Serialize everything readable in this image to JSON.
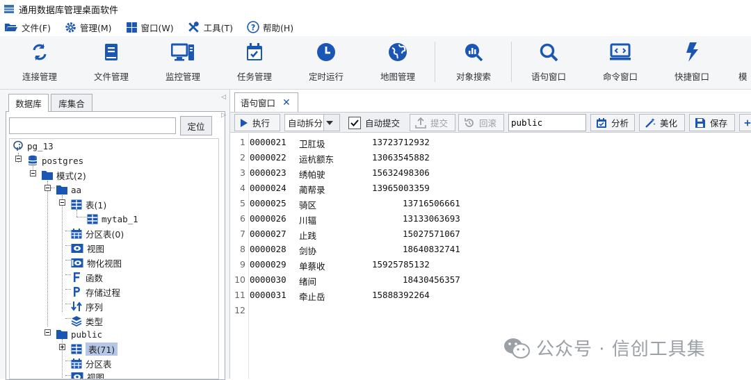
{
  "app": {
    "title": "通用数据库管理桌面软件"
  },
  "menu": [
    {
      "label": "文件(F)",
      "icon": "folder-open-icon"
    },
    {
      "label": "管理(M)",
      "icon": "gear-icon"
    },
    {
      "label": "窗口(W)",
      "icon": "windows-icon"
    },
    {
      "label": "工具(T)",
      "icon": "tools-icon"
    },
    {
      "label": "帮助(H)",
      "icon": "help-icon"
    }
  ],
  "toolbar": [
    {
      "label": "连接管理",
      "icon": "sync-icon"
    },
    {
      "label": "文件管理",
      "icon": "book-icon"
    },
    {
      "label": "监控管理",
      "icon": "monitor-icon"
    },
    {
      "label": "任务管理",
      "icon": "calendar-check-icon"
    },
    {
      "label": "定时运行",
      "icon": "clock-icon"
    },
    {
      "label": "地图管理",
      "icon": "globe-icon"
    },
    {
      "label": "对象搜索",
      "icon": "search-chart-icon"
    },
    {
      "label": "语句窗口",
      "icon": "search-icon"
    },
    {
      "label": "命令窗口",
      "icon": "terminal-icon"
    },
    {
      "label": "快捷窗口",
      "icon": "bolt-icon"
    },
    {
      "label": "模",
      "icon": ""
    }
  ],
  "left_panel": {
    "tabs": [
      "数据库",
      "库集合"
    ],
    "locate_button": "定位",
    "locate_input_value": "",
    "tree": [
      {
        "label": "pg_13",
        "icon": "elephant-icon",
        "mono": true
      },
      {
        "label": "postgres",
        "icon": "database-icon",
        "mono": true
      },
      {
        "label": "模式(2)",
        "icon": "folder-icon"
      },
      {
        "label": "aa",
        "icon": "folder-icon",
        "mono": true
      },
      {
        "label": "表(1)",
        "icon": "table-icon"
      },
      {
        "label": "mytab_1",
        "icon": "table-icon",
        "mono": true
      },
      {
        "label": "分区表(0)",
        "icon": "partition-table-icon"
      },
      {
        "label": "视图",
        "icon": "view-icon"
      },
      {
        "label": "物化视图",
        "icon": "materialized-view-icon"
      },
      {
        "label": "函数",
        "icon": "function-icon"
      },
      {
        "label": "存储过程",
        "icon": "procedure-icon"
      },
      {
        "label": "序列",
        "icon": "sequence-icon"
      },
      {
        "label": "类型",
        "icon": "type-icon"
      },
      {
        "label": "public",
        "icon": "folder-icon",
        "mono": true
      },
      {
        "label": "表(71)",
        "icon": "table-icon",
        "selected": true
      },
      {
        "label": "分区表",
        "icon": "partition-table-icon"
      },
      {
        "label": "视图",
        "icon": "view-icon"
      }
    ]
  },
  "sql_window": {
    "tab_label": "语句窗口",
    "toolbar": {
      "execute": "执行",
      "split_mode": "自动拆分",
      "auto_commit_label": "自动提交",
      "auto_commit_checked": true,
      "commit": "提交",
      "rollback": "回滚",
      "schema": "public",
      "analyze": "分析",
      "beautify": "美化",
      "save": "保存"
    },
    "lines": [
      {
        "n": "1",
        "id": "0000021",
        "name": "卫肛圾",
        "phone": "13723712932"
      },
      {
        "n": "2",
        "id": "0000022",
        "name": "运杭额东",
        "phone": "13063545882"
      },
      {
        "n": "3",
        "id": "0000023",
        "name": "绣帕驶",
        "phone": "15632498306"
      },
      {
        "n": "4",
        "id": "0000024",
        "name": "蔺帮录",
        "phone": "13965003359"
      },
      {
        "n": "5",
        "id": "0000025",
        "name": "骑区",
        "phone": "13716506661"
      },
      {
        "n": "6",
        "id": "0000026",
        "name": "川辐",
        "phone": "13133063693"
      },
      {
        "n": "7",
        "id": "0000027",
        "name": "止践",
        "phone": "15027571067"
      },
      {
        "n": "8",
        "id": "0000028",
        "name": "剑协",
        "phone": "18640832741"
      },
      {
        "n": "9",
        "id": "0000029",
        "name": "单蔡收",
        "phone": "15925785132"
      },
      {
        "n": "10",
        "id": "0000030",
        "name": "绪间",
        "phone": "18430456357"
      },
      {
        "n": "11",
        "id": "0000031",
        "name": "牵止岳",
        "phone": "15888392264"
      },
      {
        "n": "12",
        "id": "",
        "name": "",
        "phone": ""
      }
    ]
  },
  "watermark": {
    "text": "公众号 · 信创工具集"
  },
  "colors": {
    "accent": "#1a56b4",
    "selection": "#b5c6e6"
  }
}
